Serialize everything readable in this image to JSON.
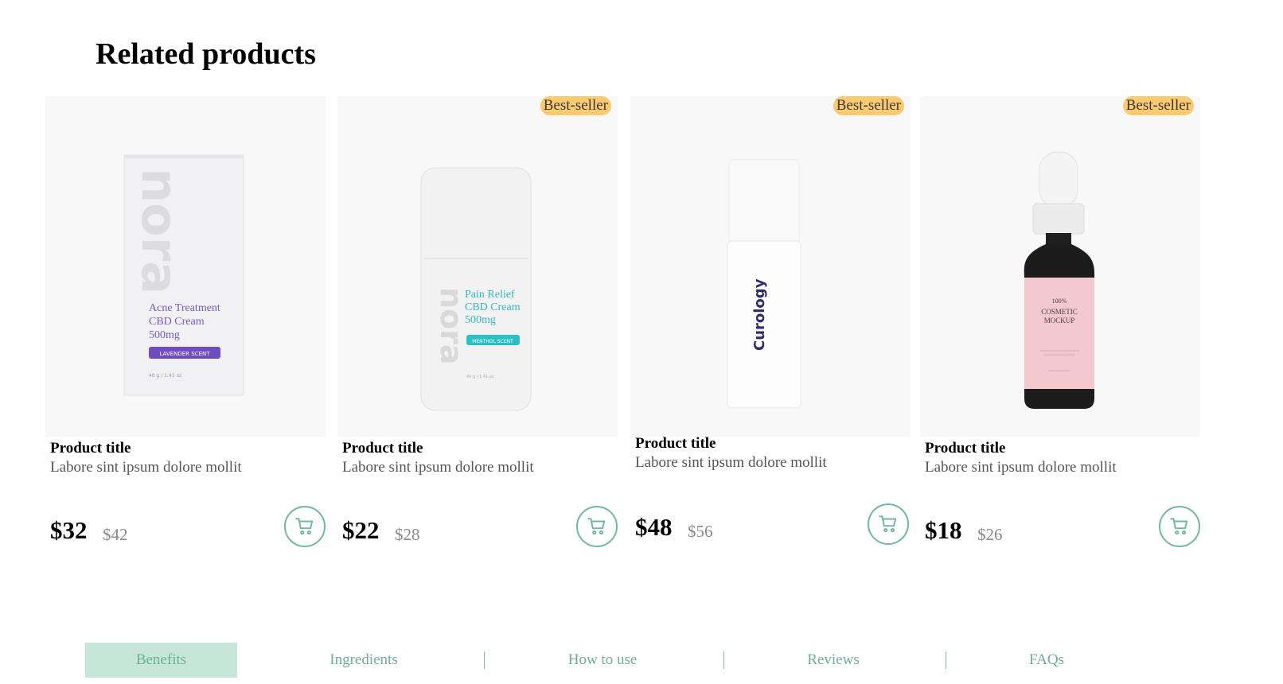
{
  "section": {
    "title": "Related products"
  },
  "products": [
    {
      "title": "Product title",
      "description": "Labore sint ipsum dolore mollit",
      "price": "$32",
      "old_price": "$42",
      "badge": "",
      "image": {
        "brand": "nora",
        "line1": "Acne Treatment",
        "line2": "CBD Cream",
        "line3": "500mg",
        "tag": "LAVENDER SCENT",
        "weight": "40 g / 1.41 oz"
      }
    },
    {
      "title": "Product title",
      "description": "Labore sint ipsum dolore mollit",
      "price": "$22",
      "old_price": "$28",
      "badge": "Best-seller",
      "image": {
        "brand": "nora",
        "line1": "Pain Relief",
        "line2": "CBD Cream",
        "line3": "500mg",
        "tag": "MENTHOL SCENT",
        "weight": "40 g / 1.41 oz"
      }
    },
    {
      "title": "Product title",
      "description": "Labore sint ipsum dolore mollit",
      "price": "$48",
      "old_price": "$56",
      "badge": "Best-seller",
      "image": {
        "brand": "Curology"
      }
    },
    {
      "title": "Product title",
      "description": "Labore sint ipsum dolore mollit",
      "price": "$18",
      "old_price": "$26",
      "badge": "Best-seller",
      "image": {
        "line1": "100%",
        "line2": "COSMETIC",
        "line3": "MOCKUP"
      }
    }
  ],
  "tabs": [
    {
      "label": "Benefits",
      "active": true
    },
    {
      "label": "Ingredients",
      "active": false
    },
    {
      "label": "How to use",
      "active": false
    },
    {
      "label": "Reviews",
      "active": false
    },
    {
      "label": "FAQs",
      "active": false
    }
  ],
  "colors": {
    "accent": "#6fb8a1",
    "badge": "#fbc96e",
    "active_tab": "#c6e6da",
    "image_bg": "#f8f8f8"
  },
  "icons": {
    "cart": "shopping-cart-icon"
  }
}
